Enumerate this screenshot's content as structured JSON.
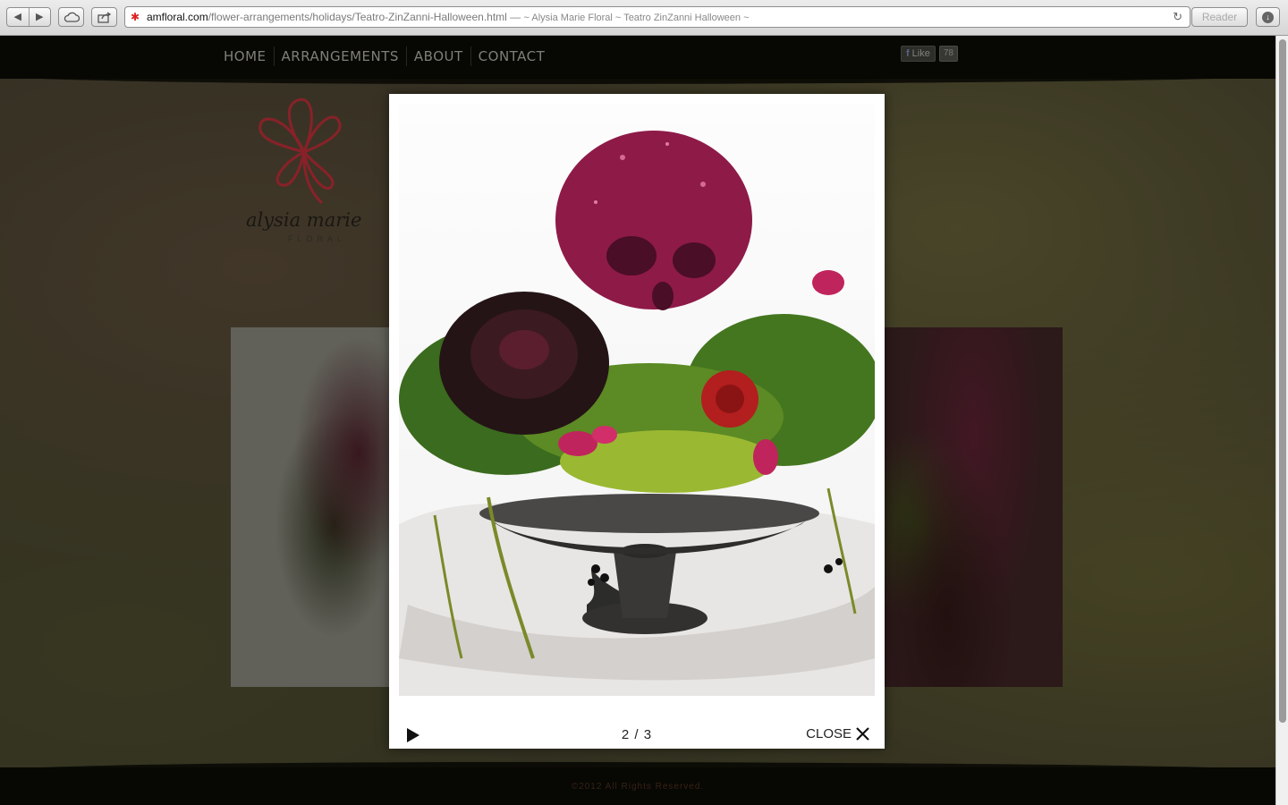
{
  "browser": {
    "url_domain": "amfloral.com",
    "url_path": "/flower-arrangements/holidays/Teatro-ZinZanni-Halloween.html",
    "url_separator": " — ",
    "page_title": "~ Alysia Marie Floral ~ Teatro ZinZanni Halloween ~",
    "reader_label": "Reader",
    "back_glyph": "◀",
    "forward_glyph": "▶",
    "reload_glyph": "↻",
    "favicon_glyph": "✱"
  },
  "nav": {
    "items": [
      {
        "label": "HOME"
      },
      {
        "label": "ARRANGEMENTS"
      },
      {
        "label": "ABOUT"
      },
      {
        "label": "CONTACT"
      }
    ]
  },
  "facebook": {
    "like_label": "Like",
    "f_glyph": "f",
    "count": "78"
  },
  "logo": {
    "name": "alysia marie",
    "subtitle": "FLORAL",
    "accent_color": "#c8283a"
  },
  "lightbox": {
    "counter": "2 / 3",
    "close_label": "CLOSE"
  },
  "footer": {
    "copyright": "©2012 All Rights Reserved."
  },
  "colors": {
    "nav_text": "#b9b9b3",
    "skull_magenta": "#8e1a48",
    "chrome_bg": "#dcdcdc"
  }
}
